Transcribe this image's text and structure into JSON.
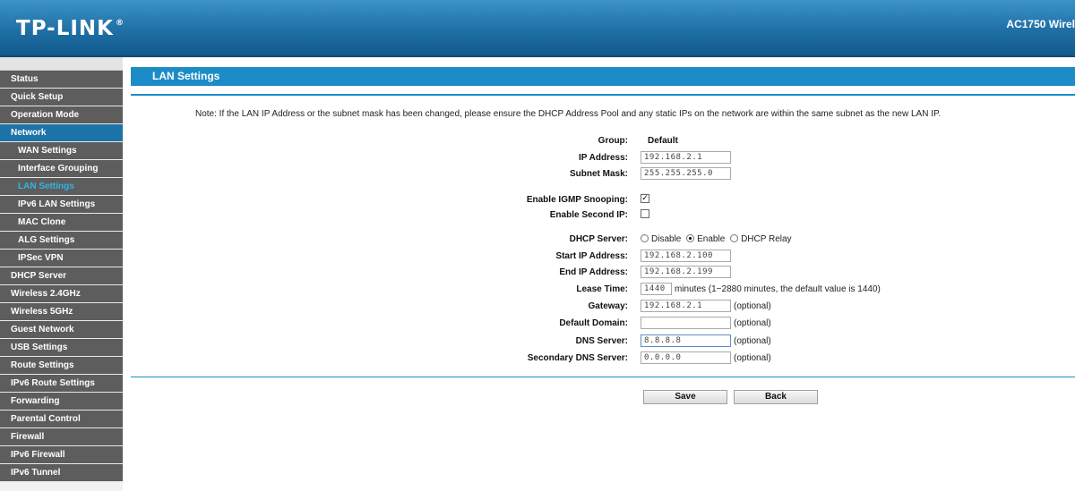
{
  "header": {
    "logo": "TP-LINK",
    "logo_mark": "®",
    "model": "AC1750 Wirel"
  },
  "sidebar": {
    "items": [
      {
        "label": "Status",
        "sub": false
      },
      {
        "label": "Quick Setup",
        "sub": false
      },
      {
        "label": "Operation Mode",
        "sub": false
      },
      {
        "label": "Network",
        "sub": false,
        "active": true
      },
      {
        "label": "WAN Settings",
        "sub": true
      },
      {
        "label": "Interface Grouping",
        "sub": true
      },
      {
        "label": "LAN Settings",
        "sub": true,
        "current": true
      },
      {
        "label": "IPv6 LAN Settings",
        "sub": true
      },
      {
        "label": "MAC Clone",
        "sub": true
      },
      {
        "label": "ALG Settings",
        "sub": true
      },
      {
        "label": "IPSec VPN",
        "sub": true
      },
      {
        "label": "DHCP Server",
        "sub": false
      },
      {
        "label": "Wireless 2.4GHz",
        "sub": false
      },
      {
        "label": "Wireless 5GHz",
        "sub": false
      },
      {
        "label": "Guest Network",
        "sub": false
      },
      {
        "label": "USB Settings",
        "sub": false
      },
      {
        "label": "Route Settings",
        "sub": false
      },
      {
        "label": "IPv6 Route Settings",
        "sub": false
      },
      {
        "label": "Forwarding",
        "sub": false
      },
      {
        "label": "Parental Control",
        "sub": false
      },
      {
        "label": "Firewall",
        "sub": false
      },
      {
        "label": "IPv6 Firewall",
        "sub": false
      },
      {
        "label": "IPv6 Tunnel",
        "sub": false
      }
    ]
  },
  "page": {
    "title": "LAN Settings",
    "note": "Note: If the LAN IP Address or the subnet mask has been changed, please ensure the DHCP Address Pool and any static IPs on the network are within the same subnet as the new LAN IP."
  },
  "form": {
    "group_label": "Group:",
    "group_value": "Default",
    "ip_label": "IP Address:",
    "ip_value": "192.168.2.1",
    "mask_label": "Subnet Mask:",
    "mask_value": "255.255.255.0",
    "igmp_label": "Enable IGMP Snooping:",
    "igmp_checked": true,
    "second_ip_label": "Enable Second IP:",
    "second_ip_checked": false,
    "dhcp_label": "DHCP Server:",
    "dhcp_options": [
      "Disable",
      "Enable",
      "DHCP Relay"
    ],
    "dhcp_selected": "Enable",
    "start_label": "Start IP Address:",
    "start_value": "192.168.2.100",
    "end_label": "End IP Address:",
    "end_value": "192.168.2.199",
    "lease_label": "Lease Time:",
    "lease_value": "1440",
    "lease_hint": "minutes (1~2880 minutes, the default value is 1440)",
    "gateway_label": "Gateway:",
    "gateway_value": "192.168.2.1",
    "domain_label": "Default Domain:",
    "domain_value": "",
    "dns_label": "DNS Server:",
    "dns_value": "8.8.8.8",
    "dns2_label": "Secondary DNS Server:",
    "dns2_value": "0.0.0.0",
    "optional": "(optional)"
  },
  "buttons": {
    "save": "Save",
    "back": "Back"
  }
}
